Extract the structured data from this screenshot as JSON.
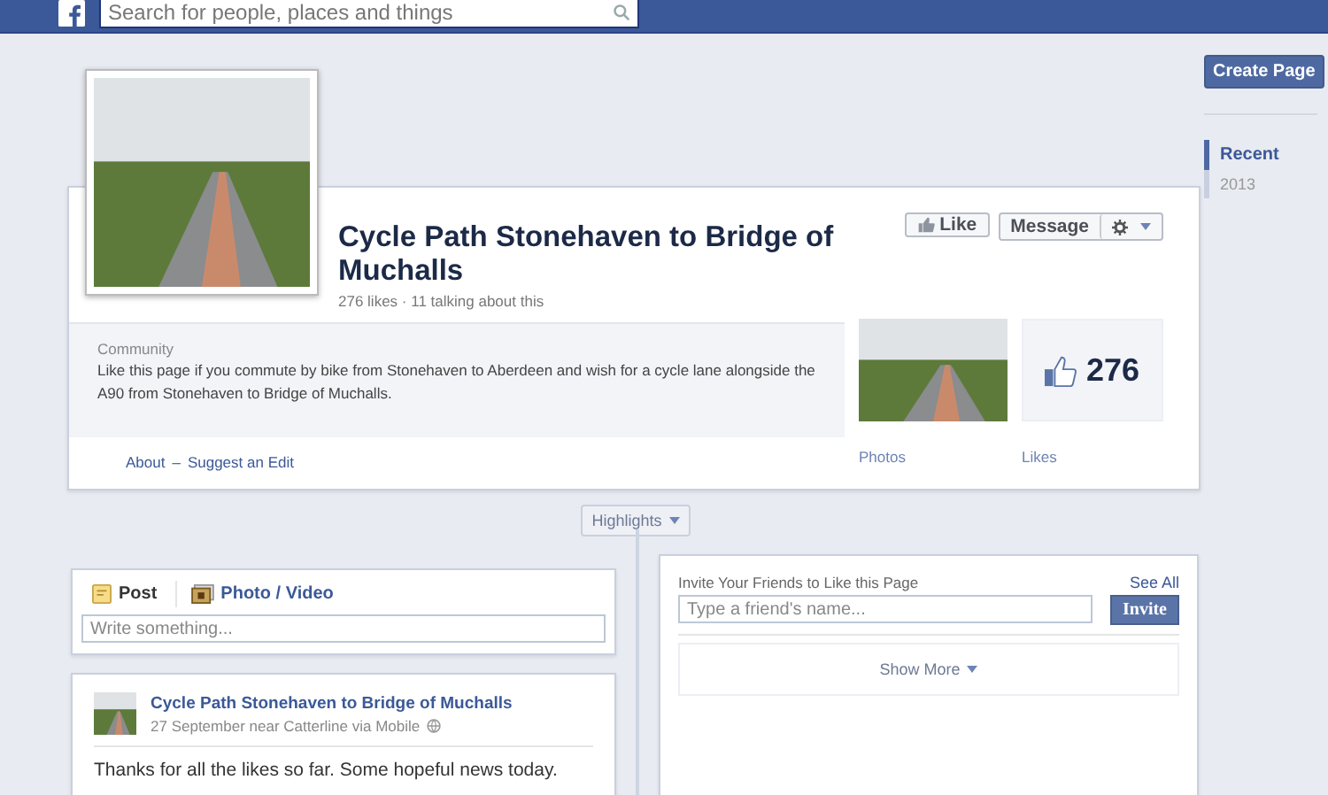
{
  "topbar": {
    "search_placeholder": "Search for people, places and things"
  },
  "sidebar": {
    "button": "Create Page",
    "years": [
      {
        "label": "Recent",
        "selected": true
      },
      {
        "label": "2013",
        "selected": false
      }
    ]
  },
  "page": {
    "title": "Cycle Path Stonehaven to Bridge of Muchalls",
    "stats": "276 likes · 11 talking about this",
    "like_button": "Like",
    "message_button": "Message",
    "category": "Community",
    "about_text": "Like this page if you commute by bike from Stonehaven to Aberdeen and wish for a cycle lane alongside the A90 from Stonehaven to Bridge of Muchalls.",
    "links": [
      "About",
      "Suggest an Edit"
    ],
    "link_separator": "–",
    "photos_label": "Photos",
    "likes_count": "276",
    "likes_label": "Likes"
  },
  "timeline": {
    "highlights": "Highlights",
    "composer": {
      "tabs": [
        {
          "label": "Post",
          "kind": "post",
          "selected": true
        },
        {
          "label": "Photo / Video",
          "kind": "photo",
          "selected": false
        }
      ],
      "placeholder": "Write something..."
    },
    "post": {
      "author": "Cycle Path Stonehaven to Bridge of Muchalls",
      "meta": "27 September near Catterline via Mobile",
      "text": "Thanks for all the likes so far. Some hopeful news today."
    },
    "invite": {
      "title": "Invite Your Friends to Like this Page",
      "see_all": "See All",
      "placeholder": "Type a friend's name...",
      "button": "Invite",
      "show_more": "Show More"
    }
  }
}
